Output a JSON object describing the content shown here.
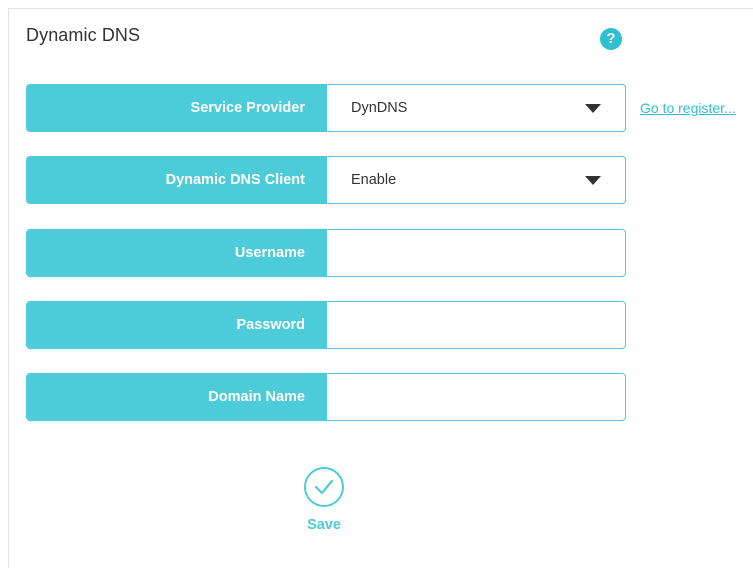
{
  "header": {
    "title": "Dynamic DNS",
    "help_icon": "question-circle-icon",
    "help_glyph": "?"
  },
  "form": {
    "service_provider": {
      "label": "Service Provider",
      "value": "DynDNS"
    },
    "ddns_client": {
      "label": "Dynamic DNS Client",
      "value": "Enable"
    },
    "username": {
      "label": "Username",
      "value": ""
    },
    "password": {
      "label": "Password",
      "value": ""
    },
    "domain_name": {
      "label": "Domain Name",
      "value": ""
    }
  },
  "links": {
    "register": "Go to register..."
  },
  "actions": {
    "save_label": "Save",
    "save_icon": "check-circle-icon"
  },
  "colors": {
    "accent": "#4ccbd8",
    "text": "#333333",
    "link": "#2fbfcf"
  }
}
